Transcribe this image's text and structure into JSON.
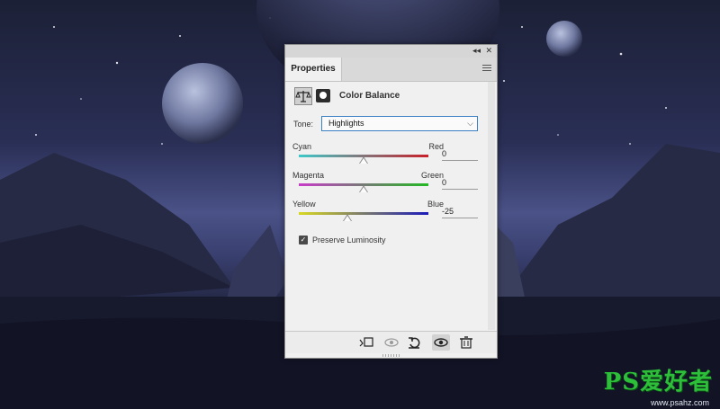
{
  "panel": {
    "tab_label": "Properties",
    "collapse_glyph": "◂◂",
    "close_glyph": "✕",
    "adjustment_title": "Color Balance",
    "tone": {
      "label": "Tone:",
      "value": "Highlights"
    },
    "sliders": [
      {
        "left": "Cyan",
        "right": "Red",
        "value": "0",
        "level": 0,
        "gradient": [
          "#3ec8c8",
          "#c8202a"
        ]
      },
      {
        "left": "Magenta",
        "right": "Green",
        "value": "0",
        "level": 0,
        "gradient": [
          "#c83cc8",
          "#22b822"
        ]
      },
      {
        "left": "Yellow",
        "right": "Blue",
        "value": "-25",
        "level": -25,
        "gradient": [
          "#d8d820",
          "#1a1ab8"
        ]
      }
    ],
    "preserve_luminosity": {
      "label": "Preserve Luminosity",
      "checked": true
    }
  },
  "icons": {
    "adjustment": "balance-scale-icon",
    "mask": "layer-mask-icon",
    "clip": "clip-to-layer-icon",
    "view_previous": "view-previous-icon",
    "reset": "reset-icon",
    "visibility": "eye-icon",
    "delete": "trash-icon"
  },
  "watermark": {
    "brand": "PS爱好者",
    "url": "www.psahz.com"
  },
  "colors": {
    "accent": "#3b7fc4",
    "panel_bg": "#f0f0f0"
  }
}
